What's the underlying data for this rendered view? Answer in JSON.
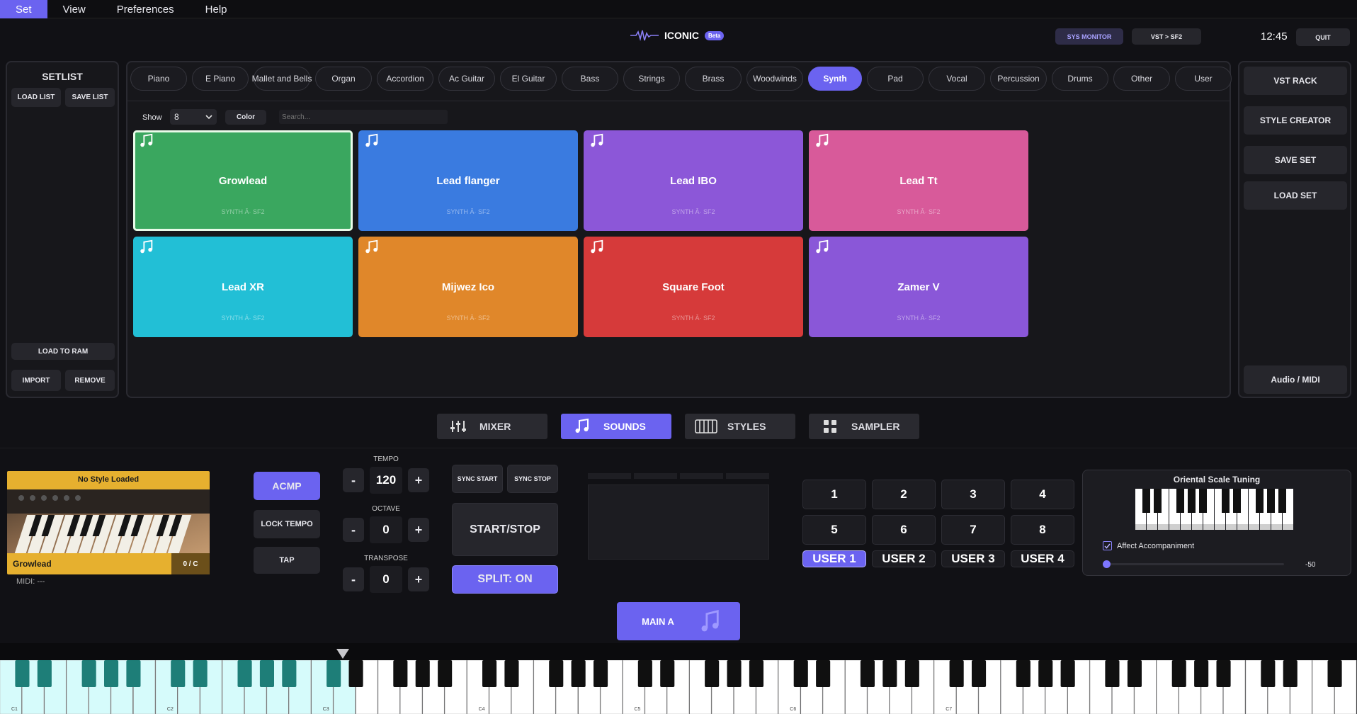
{
  "menu": [
    "Set",
    "View",
    "Preferences",
    "Help"
  ],
  "header": {
    "app_name": "ICONIC",
    "badge": "Beta",
    "sys_monitor": "SYS MONITOR",
    "vst_sf2": "VST > SF2",
    "clock": "12:45",
    "quit": "QUIT"
  },
  "setlist": {
    "title": "SETLIST",
    "load_list": "LOAD LIST",
    "save_list": "SAVE LIST",
    "load_to_ram": "LOAD TO RAM",
    "import": "IMPORT",
    "remove": "REMOVE"
  },
  "categories": [
    "Piano",
    "E Piano",
    "Mallet and Bells",
    "Organ",
    "Accordion",
    "Ac Guitar",
    "El Guitar",
    "Bass",
    "Strings",
    "Brass",
    "Woodwinds",
    "Synth",
    "Pad",
    "Vocal",
    "Percussion",
    "Drums",
    "Other",
    "User"
  ],
  "active_category": "Synth",
  "filter": {
    "show_label": "Show",
    "show_value": "8",
    "color_label": "Color",
    "search_placeholder": "Search..."
  },
  "pads": [
    {
      "name": "Growlead",
      "sub": "SYNTH Â· SF2",
      "color": "#3aa75f",
      "selected": true
    },
    {
      "name": "Lead flanger",
      "sub": "SYNTH Â· SF2",
      "color": "#3a7be0",
      "selected": false
    },
    {
      "name": "Lead IBO",
      "sub": "SYNTH Â· SF2",
      "color": "#8c57d8",
      "selected": false
    },
    {
      "name": "Lead Tt",
      "sub": "SYNTH Â· SF2",
      "color": "#d85a9a",
      "selected": false
    },
    {
      "name": "Lead XR",
      "sub": "SYNTH Â· SF2",
      "color": "#22bfd6",
      "selected": false
    },
    {
      "name": "Mijwez Ico",
      "sub": "SYNTH Â· SF2",
      "color": "#e0872a",
      "selected": false
    },
    {
      "name": "Square Foot",
      "sub": "SYNTH Â· SF2",
      "color": "#d63a3a",
      "selected": false
    },
    {
      "name": "Zamer V",
      "sub": "SYNTH Â· SF2",
      "color": "#8a57d8",
      "selected": false
    }
  ],
  "right_panel": {
    "vst_rack": "VST RACK",
    "style_creator": "STYLE CREATOR",
    "save_set": "SAVE SET",
    "load_set": "LOAD SET",
    "audio_midi": "Audio / MIDI"
  },
  "tabs": {
    "mixer": "MIXER",
    "sounds": "SOUNDS",
    "styles": "STYLES",
    "sampler": "SAMPLER"
  },
  "style_box": {
    "header": "No Style Loaded",
    "sound": "Growlead",
    "counter": "0 / C",
    "midi": "MIDI: ---"
  },
  "controls": {
    "acmp": "ACMP",
    "lock_tempo": "LOCK TEMPO",
    "tap": "TAP",
    "tempo_label": "TEMPO",
    "tempo": "120",
    "octave_label": "OCTAVE",
    "octave": "0",
    "transpose_label": "TRANSPOSE",
    "transpose": "0",
    "minus": "-",
    "plus": "+",
    "sync_start": "SYNC START",
    "sync_stop": "SYNC STOP",
    "start_stop": "START/STOP",
    "split": "SPLIT: ON"
  },
  "registrations": [
    "1",
    "2",
    "3",
    "4",
    "5",
    "6",
    "7",
    "8"
  ],
  "user_banks": [
    "USER 1",
    "USER 2",
    "USER 3",
    "USER 4"
  ],
  "tuning": {
    "title": "Oriental Scale Tuning",
    "affect": "Affect Accompaniment",
    "value": "-50"
  },
  "main": {
    "label": "MAIN A"
  },
  "keyboard": {
    "octave_labels": [
      "C1",
      "C2",
      "C3",
      "C4",
      "C5",
      "C6",
      "C7"
    ]
  },
  "colors": {
    "accent": "#6b63f0",
    "style_yellow": "#e6b02f"
  }
}
